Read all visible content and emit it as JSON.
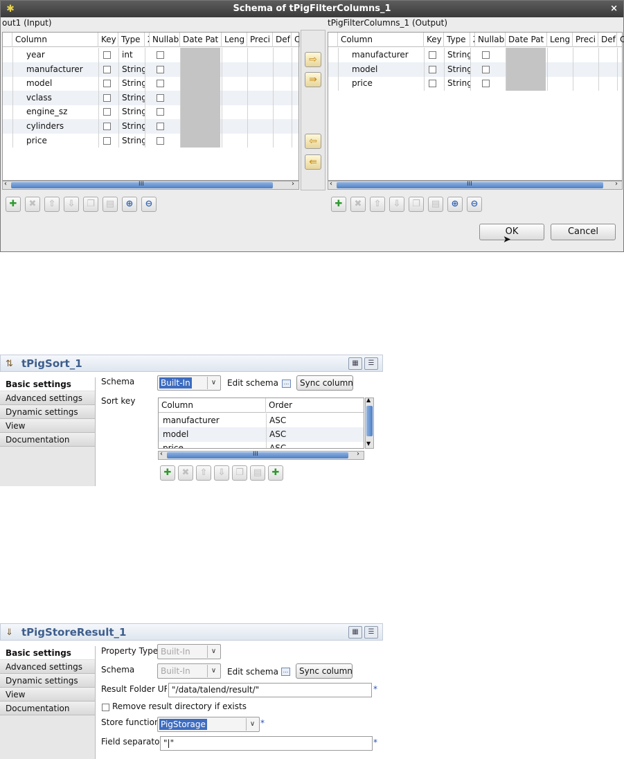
{
  "dialog": {
    "title": "Schema of tPigFilterColumns_1",
    "close_glyph": "×",
    "input_label": "out1 (Input)",
    "output_label": "tPigFilterColumns_1 (Output)",
    "columns_left": [
      "Column",
      "Key",
      "Type",
      "Z",
      "Nullab",
      "Date Pat",
      "Leng",
      "Preci",
      "Def",
      "C"
    ],
    "columns_right": [
      "Column",
      "Key",
      "Type",
      "Z",
      "Nullab",
      "Date Pat",
      "Leng",
      "Preci",
      "Def",
      "Co"
    ],
    "input_rows": [
      {
        "column": "year",
        "type": "int"
      },
      {
        "column": "manufacturer",
        "type": "String"
      },
      {
        "column": "model",
        "type": "String"
      },
      {
        "column": "vclass",
        "type": "String"
      },
      {
        "column": "engine_sz",
        "type": "String"
      },
      {
        "column": "cylinders",
        "type": "String"
      },
      {
        "column": "price",
        "type": "String"
      }
    ],
    "output_rows": [
      {
        "column": "manufacturer",
        "type": "String"
      },
      {
        "column": "model",
        "type": "String"
      },
      {
        "column": "price",
        "type": "String"
      }
    ],
    "scroll_grip": "III",
    "ok_label": "OK",
    "cancel_label": "Cancel"
  },
  "sort_panel": {
    "title": "tPigSort_1",
    "tabs": [
      "Basic settings",
      "Advanced settings",
      "Dynamic settings",
      "View",
      "Documentation"
    ],
    "schema_label": "Schema",
    "schema_value": "Built-In",
    "edit_schema_label": "Edit schema",
    "edit_schema_btn": "...",
    "sync_label": "Sync columns",
    "sort_key_label": "Sort key",
    "table_headers": [
      "Column",
      "Order"
    ],
    "rows": [
      {
        "column": "manufacturer",
        "order": "ASC"
      },
      {
        "column": "model",
        "order": "ASC"
      },
      {
        "column": "price",
        "order": "ASC"
      }
    ],
    "scroll_grip": "III"
  },
  "store_panel": {
    "title": "tPigStoreResult_1",
    "tabs": [
      "Basic settings",
      "Advanced settings",
      "Dynamic settings",
      "View",
      "Documentation"
    ],
    "property_type_label": "Property Type",
    "property_type_value": "Built-In",
    "schema_label": "Schema",
    "schema_value": "Built-In",
    "edit_schema_label": "Edit schema",
    "edit_schema_btn": "...",
    "sync_label": "Sync columns",
    "result_folder_label": "Result Folder URI",
    "result_folder_value": "\"/data/talend/result/\"",
    "remove_dir_label": "Remove result directory if exists",
    "store_function_label": "Store function",
    "store_function_value": "PigStorage",
    "field_sep_label": "Field separator",
    "field_sep_value": "\"|\"",
    "required_mark": "*"
  },
  "colors": {
    "title_bar": "#4a4a4a",
    "selection": "#3d6cc0",
    "panel_title": "#3e5e8c",
    "add_green": "#2e9a2e"
  }
}
